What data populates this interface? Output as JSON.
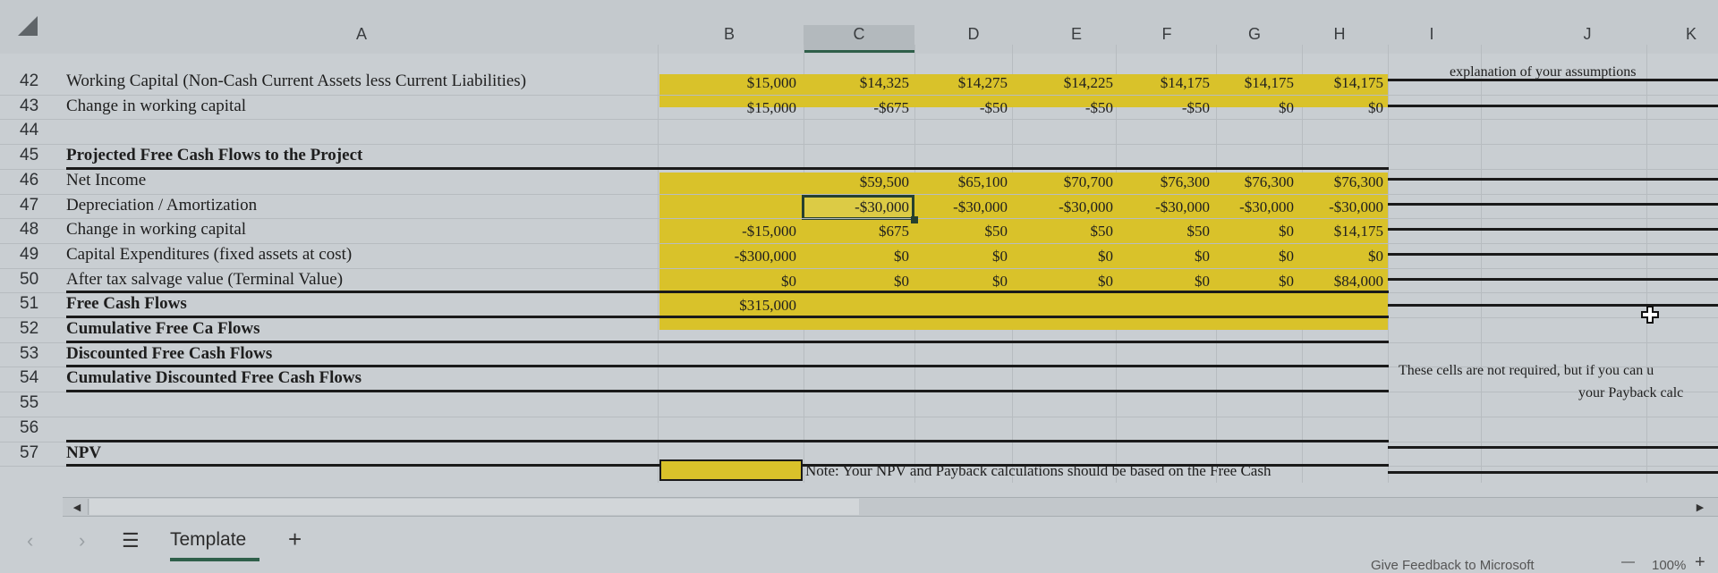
{
  "column_headers": [
    "A",
    "B",
    "C",
    "D",
    "E",
    "F",
    "G",
    "H",
    "I",
    "J",
    "K"
  ],
  "selected_column": "C",
  "rows": [
    {
      "num": "42",
      "label": "Working Capital (Non-Cash Current Assets less Current Liabilities)",
      "bold": false,
      "values": [
        "$15,000",
        "$14,325",
        "$14,275",
        "$14,225",
        "$14,175",
        "$14,175",
        "$14,175"
      ]
    },
    {
      "num": "43",
      "label": "Change in working capital",
      "bold": false,
      "values": [
        "$15,000",
        "-$675",
        "-$50",
        "-$50",
        "-$50",
        "$0",
        "$0"
      ]
    },
    {
      "num": "44",
      "label": "",
      "bold": false,
      "values": [
        "",
        "",
        "",
        "",
        "",
        "",
        ""
      ]
    },
    {
      "num": "45",
      "label": "Projected Free Cash Flows to the Project",
      "bold": true,
      "values": [
        "",
        "",
        "",
        "",
        "",
        "",
        ""
      ]
    },
    {
      "num": "46",
      "label": "Net Income",
      "bold": false,
      "values": [
        "",
        "$59,500",
        "$65,100",
        "$70,700",
        "$76,300",
        "$76,300",
        "$76,300"
      ]
    },
    {
      "num": "47",
      "label": "Depreciation / Amortization",
      "bold": false,
      "values": [
        "",
        "-$30,000",
        "-$30,000",
        "-$30,000",
        "-$30,000",
        "-$30,000",
        "-$30,000"
      ]
    },
    {
      "num": "48",
      "label": "Change in working capital",
      "bold": false,
      "values": [
        "-$15,000",
        "$675",
        "$50",
        "$50",
        "$50",
        "$0",
        "$14,175"
      ]
    },
    {
      "num": "49",
      "label": "Capital Expenditures (fixed assets at cost)",
      "bold": false,
      "values": [
        "-$300,000",
        "$0",
        "$0",
        "$0",
        "$0",
        "$0",
        "$0"
      ]
    },
    {
      "num": "50",
      "label": "After tax salvage value (Terminal Value)",
      "bold": false,
      "values": [
        "$0",
        "$0",
        "$0",
        "$0",
        "$0",
        "$0",
        "$84,000"
      ]
    },
    {
      "num": "51",
      "label": "Free Cash Flows",
      "bold": true,
      "values": [
        "$315,000",
        "",
        "",
        "",
        "",
        "",
        ""
      ]
    },
    {
      "num": "52",
      "label": "Cumulative Free Ca Flows",
      "bold": true,
      "values": [
        "",
        "",
        "",
        "",
        "",
        "",
        ""
      ]
    },
    {
      "num": "53",
      "label": "Discounted Free Cash Flows",
      "bold": true,
      "values": [
        "",
        "",
        "",
        "",
        "",
        "",
        ""
      ]
    },
    {
      "num": "54",
      "label": "Cumulative Discounted Free Cash Flows",
      "bold": true,
      "values": [
        "",
        "",
        "",
        "",
        "",
        "",
        ""
      ]
    },
    {
      "num": "55",
      "label": "",
      "bold": false,
      "values": [
        "",
        "",
        "",
        "",
        "",
        "",
        ""
      ]
    },
    {
      "num": "56",
      "label": "",
      "bold": false,
      "values": [
        "",
        "",
        "",
        "",
        "",
        "",
        ""
      ]
    },
    {
      "num": "57",
      "label": "NPV",
      "bold": true,
      "values": [
        "",
        "",
        "",
        "",
        "",
        "",
        ""
      ]
    }
  ],
  "side_notes": {
    "assumptions": "explanation of your assumptions",
    "not_required_line1": "These cells are not required, but if you can u",
    "not_required_line2": "your Payback calc"
  },
  "npv_note": "Note: Your NPV and Payback calculations should be based on the Free Cash",
  "sheet_tabs": {
    "active": "Template",
    "add_label": "+"
  },
  "status_bar": {
    "feedback": "Give Feedback to Microsoft",
    "zoom": "100%",
    "zoom_out": "—",
    "zoom_in": "+"
  },
  "colors": {
    "highlight": "#d9c22a",
    "selection": "#26402f",
    "tab_underline": "#2f5f4a"
  }
}
